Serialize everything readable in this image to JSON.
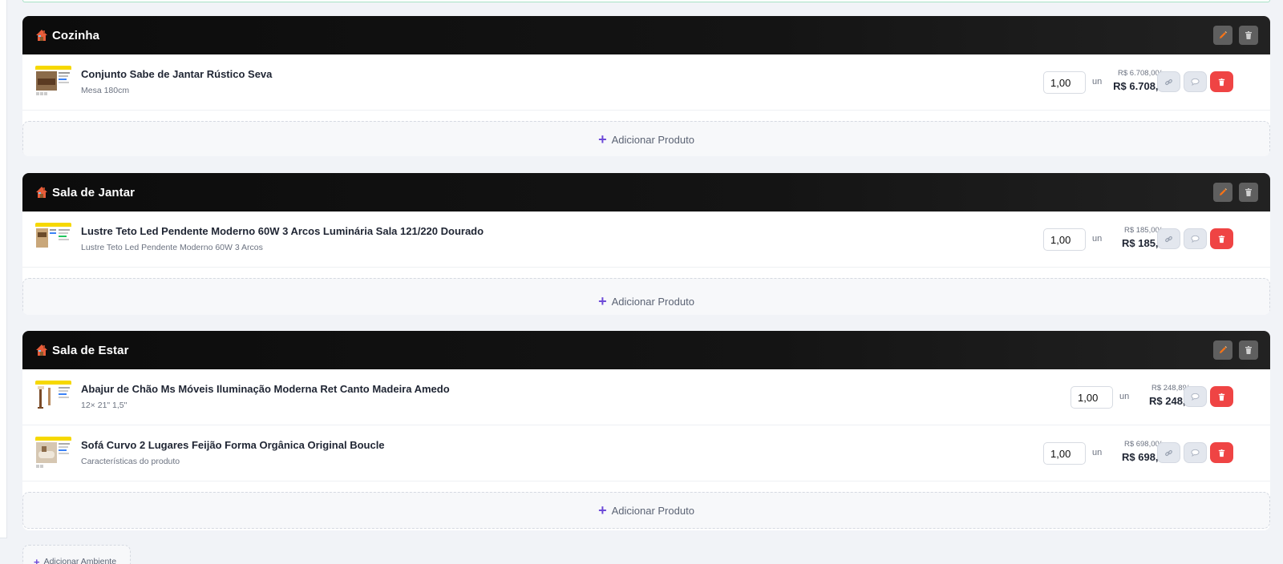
{
  "rooms": [
    {
      "title": "Cozinha",
      "items": [
        {
          "name": "Conjunto Sabe de Jantar Rústico Seva",
          "subtitle": "Mesa 180cm",
          "quantity": "1,00",
          "unit": "un",
          "unit_price": "R$ 6.708,00/un",
          "total": "R$ 6.708,00",
          "has_link": true
        }
      ],
      "add_label": "Adicionar Produto"
    },
    {
      "title": "Sala de Jantar",
      "items": [
        {
          "name": "Lustre Teto Led Pendente Moderno 60W 3 Arcos Luminária Sala 121/220 Dourado",
          "subtitle": "Lustre Teto Led Pendente Moderno 60W 3 Arcos",
          "quantity": "1,00",
          "unit": "un",
          "unit_price": "R$ 185,00/un",
          "total": "R$ 185,00",
          "has_link": true
        }
      ],
      "add_label": "Adicionar Produto"
    },
    {
      "title": "Sala de Estar",
      "items": [
        {
          "name": "Abajur de Chão Ms Móveis Iluminação Moderna Ret Canto Madeira Amedo",
          "subtitle": "12× 21\" 1,5\"",
          "quantity": "1,00",
          "unit": "un",
          "unit_price": "R$ 248,89/un",
          "total": "R$ 248,89",
          "has_link": false
        },
        {
          "name": "Sofá Curvo 2 Lugares Feijão Forma Orgânica Original Boucle",
          "subtitle": "Características do produto",
          "quantity": "1,00",
          "unit": "un",
          "unit_price": "R$ 698,00/un",
          "total": "R$ 698,00",
          "has_link": true
        }
      ],
      "add_label": "Adicionar Produto"
    }
  ],
  "add_room_label": "Adicionar Ambiente",
  "icons": {
    "room": "house-icon",
    "edit": "pencil-icon",
    "delete": "trash-icon",
    "link": "link-icon",
    "comment": "comment-icon",
    "add": "plus-icon"
  },
  "colors": {
    "header_bg": "#111111",
    "delete_red": "#ef4444",
    "edit_orange": "#f97316",
    "accent_purple": "#6d4ad8",
    "page_bg": "#f1f3f7"
  }
}
